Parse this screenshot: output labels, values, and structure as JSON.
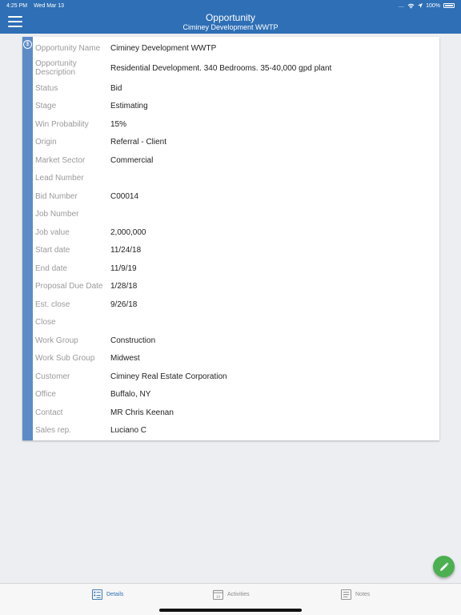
{
  "status_bar": {
    "time": "4:25 PM",
    "date": "Wed Mar 13",
    "signal": "....",
    "battery": "100%"
  },
  "header": {
    "title": "Opportunity",
    "subtitle": "Ciminey Development WWTP",
    "menu_icon": "hamburger-icon"
  },
  "card": {
    "icon": "dollar-circle-icon",
    "icon_glyph": "$",
    "fields": [
      {
        "label": "Opportunity Name",
        "value": "Ciminey Development WWTP"
      },
      {
        "label": "Opportunity Description",
        "value": "Residential Development. 340 Bedrooms. 35-40,000 gpd plant"
      },
      {
        "label": "Status",
        "value": "Bid"
      },
      {
        "label": "Stage",
        "value": "Estimating"
      },
      {
        "label": "Win Probability",
        "value": "15%"
      },
      {
        "label": "Origin",
        "value": "Referral - Client"
      },
      {
        "label": "Market Sector",
        "value": "Commercial"
      },
      {
        "label": "Lead Number",
        "value": ""
      },
      {
        "label": "Bid Number",
        "value": "C00014"
      },
      {
        "label": "Job Number",
        "value": ""
      },
      {
        "label": "Job value",
        "value": "2,000,000"
      },
      {
        "label": "Start date",
        "value": "11/24/18"
      },
      {
        "label": "End date",
        "value": "11/9/19"
      },
      {
        "label": "Proposal Due Date",
        "value": "1/28/18"
      },
      {
        "label": "Est. close",
        "value": "9/26/18"
      },
      {
        "label": "Close",
        "value": ""
      },
      {
        "label": "Work Group",
        "value": "Construction"
      },
      {
        "label": "Work Sub Group",
        "value": "Midwest"
      },
      {
        "label": "Customer",
        "value": "Ciminey Real Estate Corporation"
      },
      {
        "label": "Office",
        "value": "Buffalo, NY"
      },
      {
        "label": "Contact",
        "value": "MR Chris Keenan"
      },
      {
        "label": "Sales rep.",
        "value": "Luciano C"
      }
    ]
  },
  "fab": {
    "icon": "pencil-icon"
  },
  "tabs": [
    {
      "label": "Details",
      "icon": "details-list-icon",
      "active": true
    },
    {
      "label": "Activities",
      "icon": "calendar-icon",
      "active": false,
      "icon_text": "10"
    },
    {
      "label": "Notes",
      "icon": "notes-icon",
      "active": false
    }
  ],
  "colors": {
    "primary": "#2e6fb5",
    "stripe": "#5b8cc8",
    "fab": "#4caf50",
    "background": "#eceef1"
  }
}
